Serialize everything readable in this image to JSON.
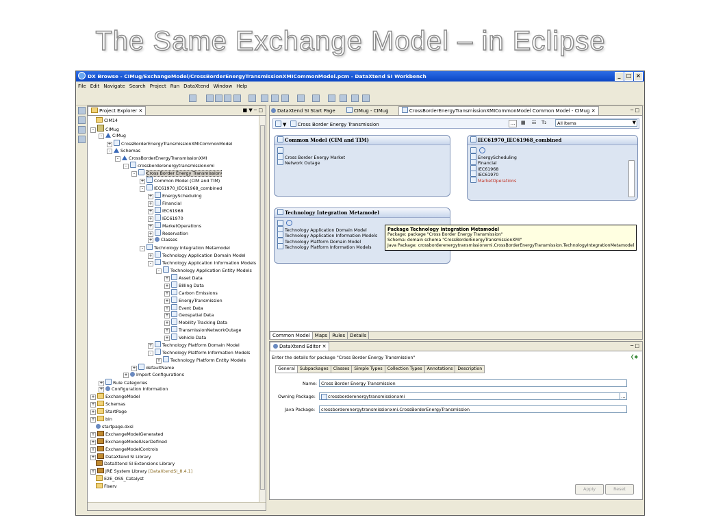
{
  "slide": {
    "title": "The Same Exchange Model – in Eclipse"
  },
  "window": {
    "title": "DX Browse - CIMug/ExchangeModel/CrossBorderEnergyTransmissionXMICommonModel.pcm - DataXtend SI Workbench",
    "buttons": [
      "_",
      "□",
      "×"
    ]
  },
  "menu": [
    "File",
    "Edit",
    "Navigate",
    "Search",
    "Project",
    "Run",
    "DataXtend",
    "Window",
    "Help"
  ],
  "project_explorer": {
    "tab": "Project Explorer",
    "items": [
      {
        "label": "CIM14",
        "depth": 1,
        "icon": "folder",
        "exp": ""
      },
      {
        "label": "CIMug",
        "depth": 1,
        "icon": "proj",
        "exp": "-"
      },
      {
        "label": "CIMug",
        "depth": 2,
        "icon": "tri",
        "exp": "-"
      },
      {
        "label": "CrossBorderEnergyTransmissionXMICommonModel",
        "depth": 3,
        "icon": "pkg",
        "exp": "+"
      },
      {
        "label": "Schemas",
        "depth": 3,
        "icon": "tri",
        "exp": "-"
      },
      {
        "label": "CrossBorderEnergyTransmissionXMI",
        "depth": 4,
        "icon": "tri",
        "exp": "-"
      },
      {
        "label": "crossborderenergytransmissionxmi",
        "depth": 5,
        "icon": "pkg",
        "exp": "-"
      },
      {
        "label": "Cross Border Energy Transmission",
        "depth": 6,
        "icon": "pkg",
        "exp": "-",
        "selected": true
      },
      {
        "label": "Common Model (CIM and TIM)",
        "depth": 7,
        "icon": "pkg",
        "exp": "+"
      },
      {
        "label": "IEC61970_IEC61968_combined",
        "depth": 7,
        "icon": "pkg",
        "exp": "-"
      },
      {
        "label": "EnergyScheduling",
        "depth": 8,
        "icon": "pkg",
        "exp": "+"
      },
      {
        "label": "Financial",
        "depth": 8,
        "icon": "pkg",
        "exp": "+"
      },
      {
        "label": "IEC61968",
        "depth": 8,
        "icon": "pkg",
        "exp": "+"
      },
      {
        "label": "IEC61970",
        "depth": 8,
        "icon": "pkg",
        "exp": "+"
      },
      {
        "label": "MarketOperations",
        "depth": 8,
        "icon": "pkg",
        "exp": "+"
      },
      {
        "label": "Reservation",
        "depth": 8,
        "icon": "pkg",
        "exp": "+"
      },
      {
        "label": "Classes",
        "depth": 8,
        "icon": "gear",
        "exp": "+"
      },
      {
        "label": "Technology Integration Metamodel",
        "depth": 7,
        "icon": "pkg",
        "exp": "-"
      },
      {
        "label": "Technology Application Domain Model",
        "depth": 8,
        "icon": "pkg",
        "exp": "+"
      },
      {
        "label": "Technology Application Information Models",
        "depth": 8,
        "icon": "pkg",
        "exp": "-"
      },
      {
        "label": "Technology Application Entity Models",
        "depth": 9,
        "icon": "pkg",
        "exp": "-"
      },
      {
        "label": "Asset Data",
        "depth": 10,
        "icon": "pkg",
        "exp": "+"
      },
      {
        "label": "Billing Data",
        "depth": 10,
        "icon": "pkg",
        "exp": "+"
      },
      {
        "label": "Carbon Emissions",
        "depth": 10,
        "icon": "pkg",
        "exp": "+"
      },
      {
        "label": "EnergyTransmission",
        "depth": 10,
        "icon": "pkg",
        "exp": "+"
      },
      {
        "label": "Event Data",
        "depth": 10,
        "icon": "pkg",
        "exp": "+"
      },
      {
        "label": "Geospatial Data",
        "depth": 10,
        "icon": "pkg",
        "exp": "+"
      },
      {
        "label": "Mobility Tracking Data",
        "depth": 10,
        "icon": "pkg",
        "exp": "+"
      },
      {
        "label": "TransmissionNetworkOutage",
        "depth": 10,
        "icon": "pkg",
        "exp": "+"
      },
      {
        "label": "Vehicle Data",
        "depth": 10,
        "icon": "pkg",
        "exp": "+"
      },
      {
        "label": "Technology Platform Domain Model",
        "depth": 8,
        "icon": "pkg",
        "exp": "+"
      },
      {
        "label": "Technology Platform Information Models",
        "depth": 8,
        "icon": "pkg",
        "exp": "-"
      },
      {
        "label": "Technology Platform Entity Models",
        "depth": 9,
        "icon": "pkg",
        "exp": "+"
      },
      {
        "label": "defaultName",
        "depth": 6,
        "icon": "pkg",
        "exp": "+"
      },
      {
        "label": "Import Configurations",
        "depth": 5,
        "icon": "gear",
        "exp": "+"
      },
      {
        "label": "Rule Categories",
        "depth": 2,
        "icon": "pkg",
        "exp": "+"
      },
      {
        "label": "Configuration Information",
        "depth": 2,
        "icon": "gear",
        "exp": "+"
      },
      {
        "label": "ExchangeModel",
        "depth": 1,
        "icon": "folder",
        "exp": "+"
      },
      {
        "label": "Schemas",
        "depth": 1,
        "icon": "folder",
        "exp": "+"
      },
      {
        "label": "StartPage",
        "depth": 1,
        "icon": "folder",
        "exp": "+"
      },
      {
        "label": "bin",
        "depth": 1,
        "icon": "folder",
        "exp": "+"
      },
      {
        "label": "startpage.dxsi",
        "depth": 1,
        "icon": "gear",
        "exp": ""
      },
      {
        "label": "ExchangeModelGenerated",
        "depth": 1,
        "icon": "lib",
        "exp": "+"
      },
      {
        "label": "ExchangeModelUserDefined",
        "depth": 1,
        "icon": "lib",
        "exp": "+"
      },
      {
        "label": "ExchangeModelControls",
        "depth": 1,
        "icon": "lib",
        "exp": "+"
      },
      {
        "label": "DataXtend SI Library",
        "depth": 1,
        "icon": "lib",
        "exp": "+"
      },
      {
        "label": "DataXtend SI Extensions Library",
        "depth": 1,
        "icon": "lib",
        "exp": ""
      },
      {
        "label": "JRE System Library",
        "suffix": "[DataXtendSI_8.4.1]",
        "depth": 1,
        "icon": "lib",
        "exp": "+"
      },
      {
        "label": "E2E_OSS_Catalyst",
        "depth": 1,
        "icon": "folder",
        "exp": ""
      },
      {
        "label": "Fiserv",
        "depth": 1,
        "icon": "folder",
        "exp": ""
      }
    ]
  },
  "editor_tabs": [
    "DataXtend SI Start Page",
    "CIMug - CIMug",
    "CrossBorderEnergyTransmissionXMICommonModel Common Model - CIMug"
  ],
  "model_toolbar": {
    "breadcrumb": "Cross Border Energy Transmission",
    "filter": "All items"
  },
  "diagram": {
    "common_model": {
      "title": "Common Model (CIM and TIM)",
      "items": [
        "Cross Border Energy Market",
        "Network Outage"
      ]
    },
    "iec_combined": {
      "title": "IEC61970_IEC61968_combined",
      "items": [
        "EnergyScheduling",
        "Financial",
        "IEC61968",
        "IEC61970",
        "MarketOperations"
      ]
    },
    "tim": {
      "title": "Technology Integration Metamodel",
      "items": [
        "Technology Application Domain Model",
        "Technology Application Information Models",
        "Technology Platform Domain Model",
        "Technology Platform Information Models"
      ]
    }
  },
  "tooltip": {
    "title": "Package Technology Integration Metamodel",
    "lines": [
      "Package: package \"Cross Border Energy Transmission\"",
      "Schema: domain schema \"CrossBorderEnergyTransmissionXMI\"",
      "Java Package: crossborderenergytransmissionxmi.CrossBorderEnergyTransmission.TechnologyIntegrationMetamodel"
    ]
  },
  "bottom_tabs": [
    "Common Model",
    "Maps",
    "Rules",
    "Details"
  ],
  "editor": {
    "tab": "DataXtend Editor",
    "description": "Enter the details for package \"Cross Border Energy Transmission\"",
    "subtabs": [
      "General",
      "Subpackages",
      "Classes",
      "Simple Types",
      "Collection Types",
      "Annotations",
      "Description"
    ],
    "name_label": "Name:",
    "name_value": "Cross Border Energy Transmission",
    "owning_label": "Owning Package:",
    "owning_value": "crossborderenergytransmissionxmi",
    "browse": "...",
    "java_label": "Java Package:",
    "java_value": "crossborderenergytransmissionxmi.CrossBorderEnergyTransmission",
    "apply": "Apply",
    "reset": "Reset"
  }
}
